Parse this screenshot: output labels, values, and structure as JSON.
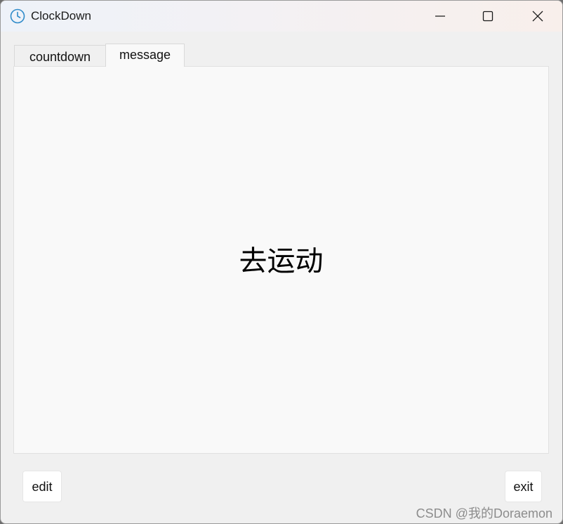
{
  "window": {
    "title": "ClockDown",
    "icon": "clock-icon",
    "controls": {
      "minimize_icon": "minimize-icon",
      "maximize_icon": "maximize-icon",
      "close_icon": "close-icon"
    }
  },
  "tabs": [
    {
      "label": "countdown",
      "active": false
    },
    {
      "label": "message",
      "active": true
    }
  ],
  "message": {
    "text": "去运动"
  },
  "buttons": {
    "edit_label": "edit",
    "exit_label": "exit"
  },
  "watermark": "CSDN @我的Doraemon",
  "colors": {
    "accent": "#2e8bc9",
    "panel_background": "#f9f9f9",
    "window_background": "#f0f0f0"
  }
}
